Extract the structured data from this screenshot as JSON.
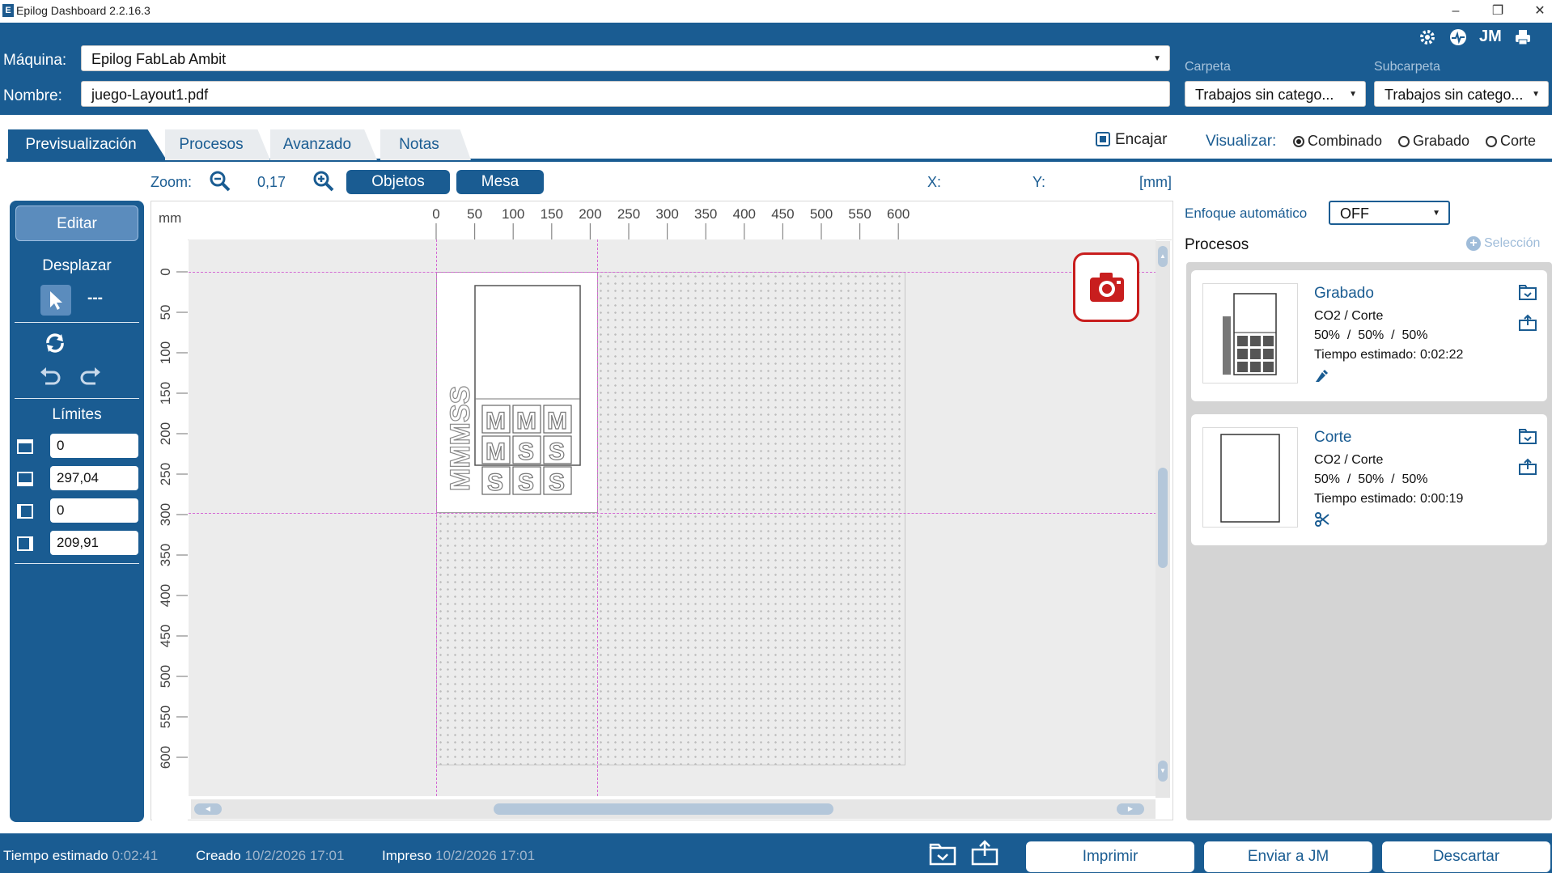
{
  "window": {
    "title": "Epilog Dashboard 2.2.16.3",
    "minimize": "–",
    "restore": "❐",
    "close": "✕"
  },
  "header": {
    "machine_label": "Máquina:",
    "machine_value": "Epilog FabLab Ambit",
    "name_label": "Nombre:",
    "name_value": "juego-Layout1.pdf",
    "folder_label": "Carpeta",
    "folder_value": "Trabajos sin catego...",
    "subfolder_label": "Subcarpeta",
    "subfolder_value": "Trabajos sin catego...",
    "user_initials": "JM",
    "icons": [
      "gear-icon",
      "status-icon",
      "user-icon",
      "printer-icon"
    ]
  },
  "tabs": [
    {
      "label": "Previsualización",
      "active": true
    },
    {
      "label": "Procesos",
      "active": false
    },
    {
      "label": "Avanzado",
      "active": false
    },
    {
      "label": "Notas",
      "active": false
    }
  ],
  "view": {
    "fit_label": "Encajar",
    "fit_checked": true,
    "visualize_label": "Visualizar:",
    "options": [
      {
        "label": "Combinado",
        "selected": true
      },
      {
        "label": "Grabado",
        "selected": false
      },
      {
        "label": "Corte",
        "selected": false
      }
    ]
  },
  "zoom": {
    "label": "Zoom:",
    "value": "0,17",
    "objects_button": "Objetos",
    "table_button": "Mesa",
    "x_label": "X:",
    "y_label": "Y:",
    "units": "[mm]"
  },
  "left_panel": {
    "edit_button": "Editar",
    "move_label": "Desplazar",
    "dash_label": "---",
    "limits_label": "Límites",
    "limits": [
      "0",
      "297,04",
      "0",
      "209,91"
    ]
  },
  "rulers": {
    "unit": "mm",
    "top": [
      "0",
      "50",
      "100",
      "150",
      "200",
      "250",
      "300",
      "350",
      "400",
      "450",
      "500",
      "550",
      "600"
    ],
    "left": [
      "0",
      "50",
      "100",
      "150",
      "200",
      "250",
      "300",
      "350",
      "400",
      "450",
      "500",
      "550",
      "600"
    ]
  },
  "right_panel": {
    "autofocus_label": "Enfoque automático",
    "autofocus_value": "OFF",
    "processes_label": "Procesos",
    "selection_label": "Selección",
    "processes": [
      {
        "name": "Grabado",
        "type": "CO2 / Corte",
        "settings": "50%  /  50%  /  50%",
        "time": "Tiempo estimado: 0:02:22",
        "icon": "engrave-icon"
      },
      {
        "name": "Corte",
        "type": "CO2 / Corte",
        "settings": "50%  /  50%  /  50%",
        "time": "Tiempo estimado: 0:00:19",
        "icon": "scissors-icon"
      }
    ]
  },
  "footer": {
    "time_label": "Tiempo estimado",
    "time_value": "0:02:41",
    "created_label": "Creado",
    "created_value": "10/2/2026 17:01",
    "printed_label": "Impreso",
    "printed_value": "10/2/2026 17:01",
    "print_button": "Imprimir",
    "send_button": "Enviar a JM",
    "discard_button": "Descartar"
  },
  "colors": {
    "accent": "#1a5c92",
    "guide": "#d46ad4",
    "camera": "#c81e1e"
  }
}
